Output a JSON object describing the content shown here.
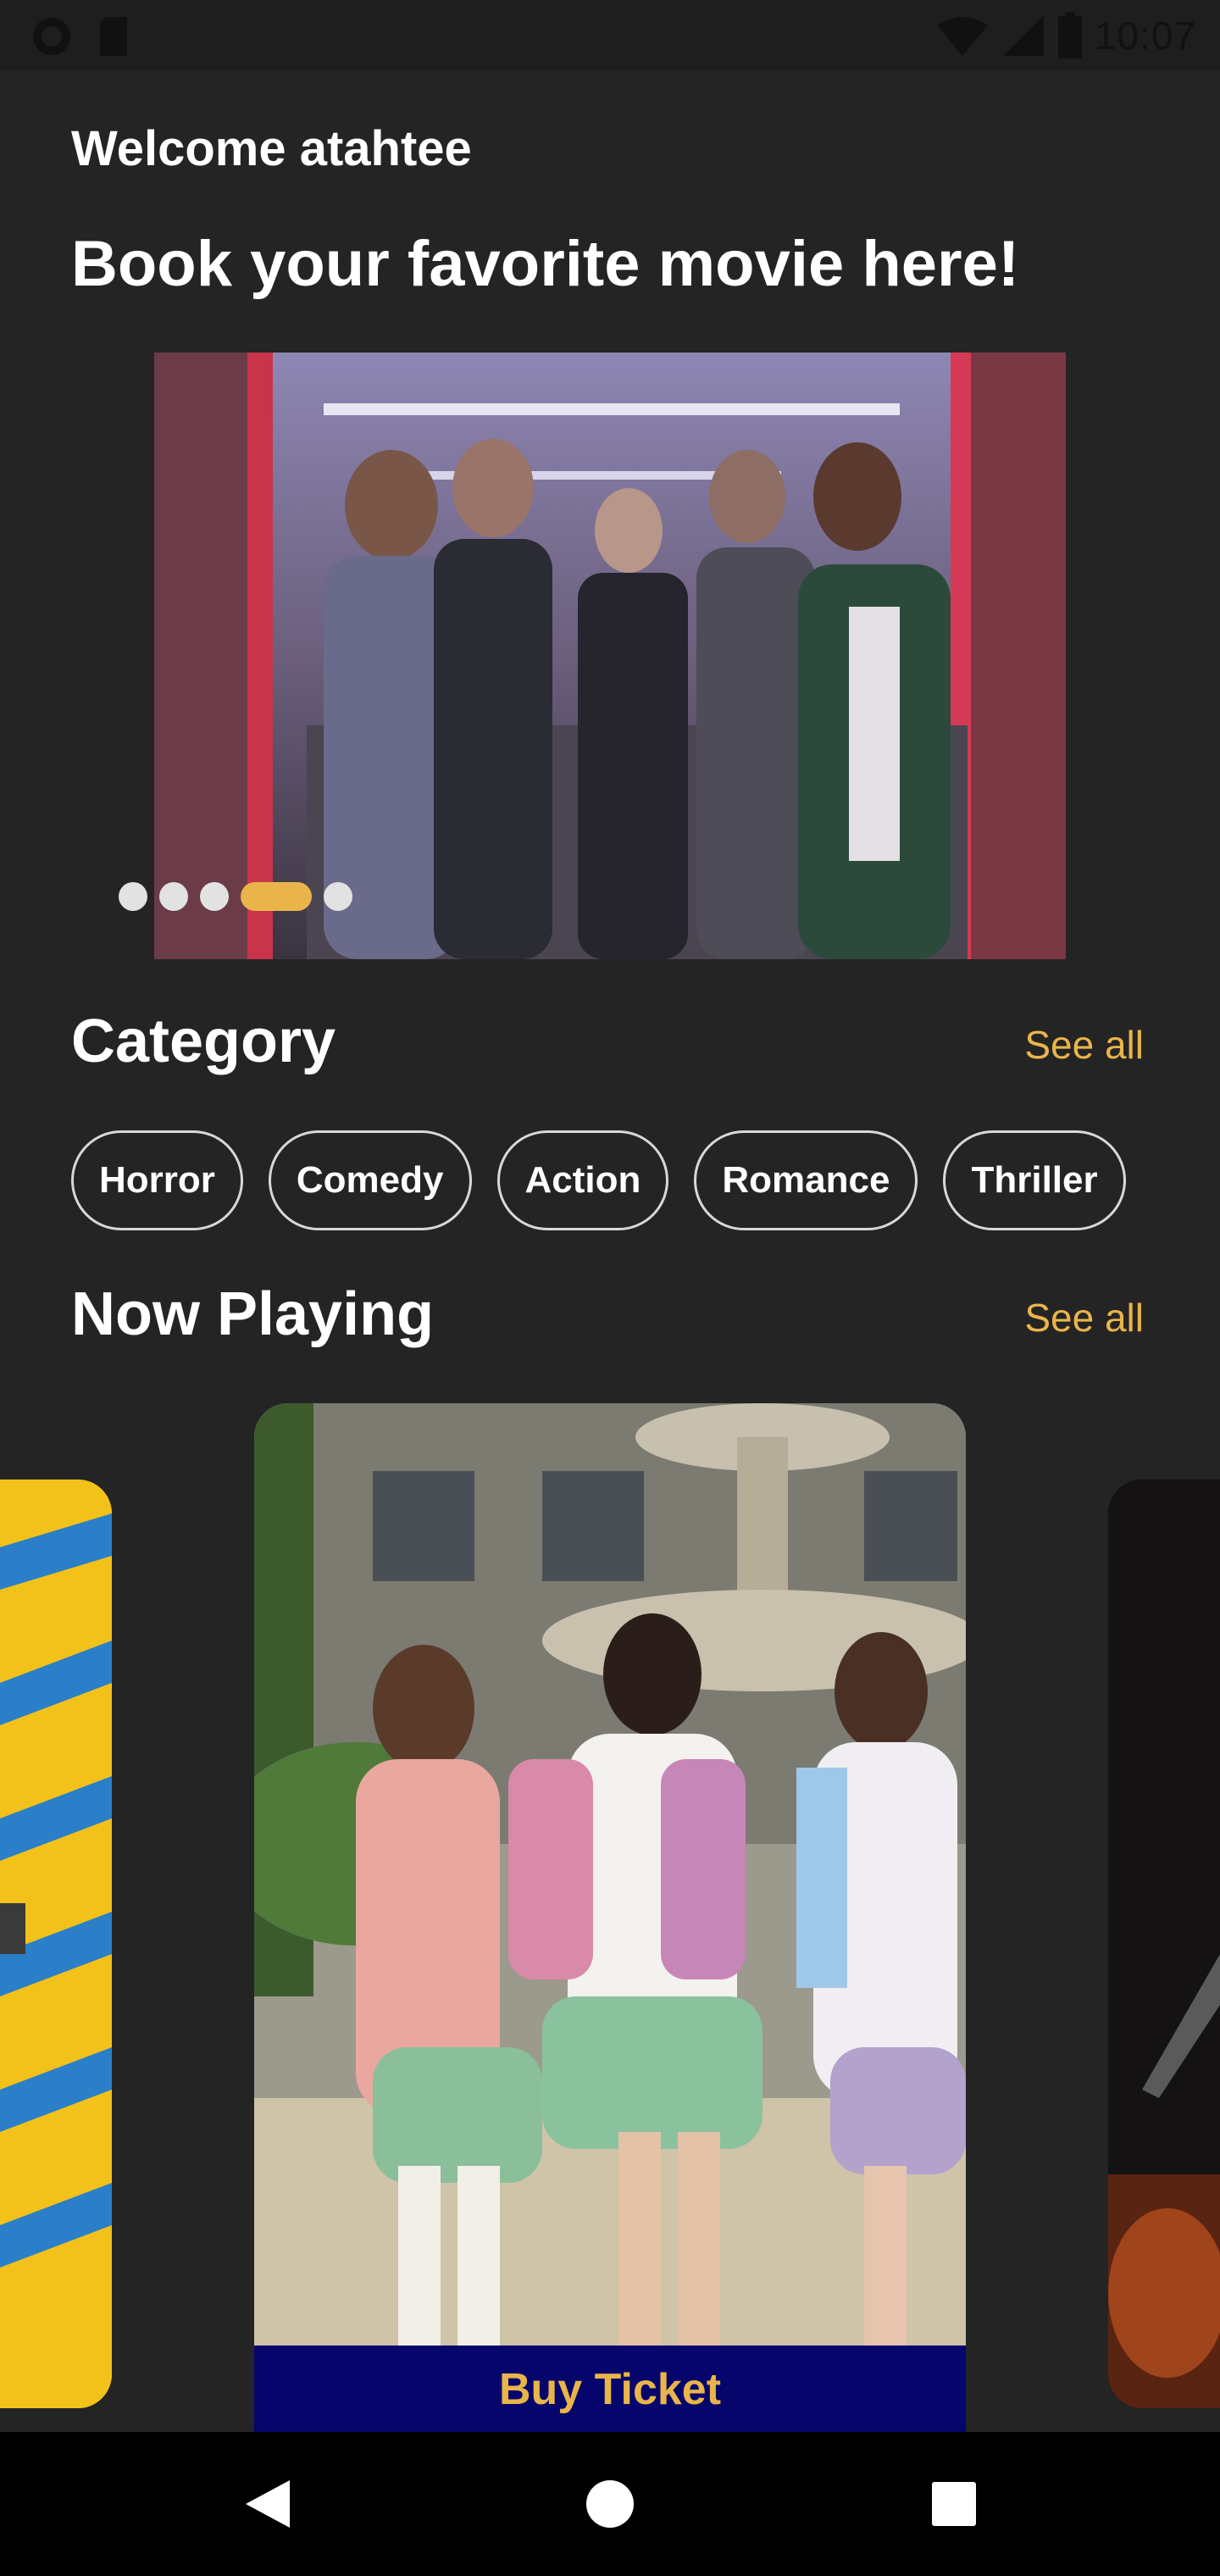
{
  "status_bar": {
    "time": "10:07",
    "icons": [
      "record-icon",
      "sd-card-icon",
      "wifi-icon",
      "signal-icon",
      "battery-icon"
    ]
  },
  "header": {
    "welcome": "Welcome atahtee",
    "headline": "Book your favorite movie here!"
  },
  "banner": {
    "slide_count": 5,
    "active_index": 3
  },
  "category": {
    "title": "Category",
    "see_all": "See all",
    "items": [
      "Horror",
      "Comedy",
      "Action",
      "Romance",
      "Thriller"
    ]
  },
  "now_playing": {
    "title": "Now Playing",
    "see_all": "See all",
    "buy_ticket": "Buy Ticket"
  },
  "colors": {
    "background": "#242424",
    "accent": "#e9b54a",
    "buy_button": "#05056b"
  },
  "nav_bar": {
    "icons": [
      "back-icon",
      "home-icon",
      "recents-icon"
    ]
  }
}
